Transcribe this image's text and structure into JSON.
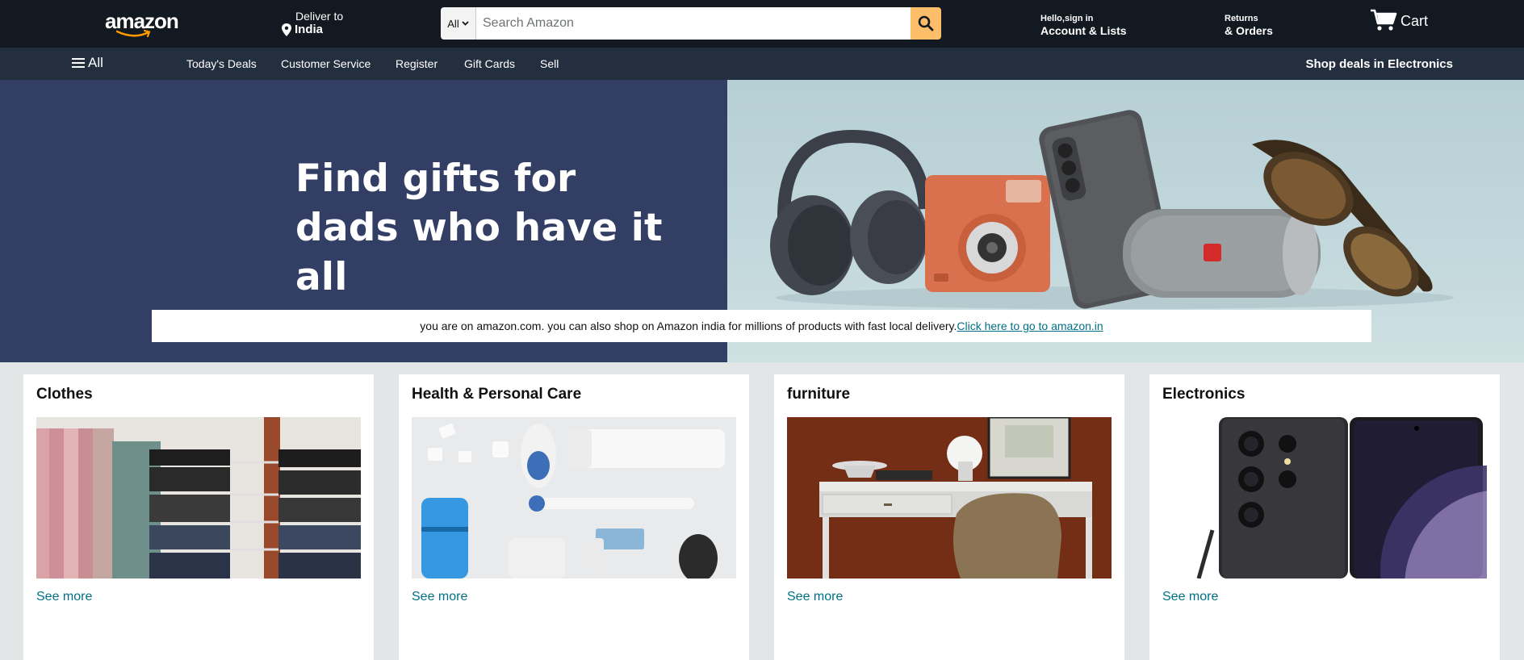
{
  "header": {
    "logo_text": "amazon",
    "deliver_label": "Deliver to",
    "deliver_location": "India",
    "search": {
      "category": "All",
      "placeholder": "Search Amazon"
    },
    "account_greeting": "Hello,sign in",
    "account_label": "Account & Lists",
    "returns_label": "Returns",
    "orders_label": "& Orders",
    "cart_label": "Cart",
    "accent_color": "#febd69"
  },
  "subnav": {
    "all_label": "All",
    "links": [
      "Today's Deals",
      "Customer Service",
      "Register",
      "Gift Cards",
      "Sell"
    ],
    "right_link": "Shop deals in Electronics"
  },
  "hero": {
    "title_line1": "Find gifts for",
    "title_line2": "dads who have it all",
    "notice_text": "you are on amazon.com. you can also shop on Amazon india for millions of products with fast local delivery.",
    "notice_link": "Click here to go to amazon.in"
  },
  "cards": [
    {
      "title": "Clothes",
      "link": "See more"
    },
    {
      "title": "Health & Personal Care",
      "link": "See more"
    },
    {
      "title": "furniture",
      "link": "See more"
    },
    {
      "title": "Electronics",
      "link": "See more"
    }
  ]
}
